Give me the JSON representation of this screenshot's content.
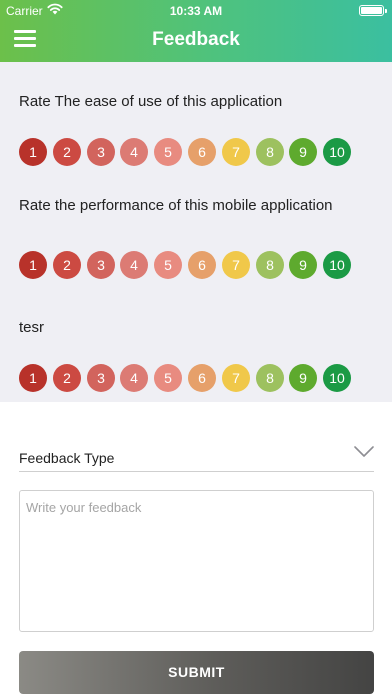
{
  "status_bar": {
    "carrier": "Carrier",
    "time": "10:33 AM"
  },
  "header": {
    "title": "Feedback",
    "menu_icon": "hamburger-menu-icon"
  },
  "scale_colors": [
    "#b8322a",
    "#cc4a42",
    "#d2645d",
    "#dc7b74",
    "#e88b80",
    "#e6a06a",
    "#f0c84a",
    "#9dc15f",
    "#5eaa2e",
    "#1b9a45"
  ],
  "questions": [
    {
      "label": "Rate The ease of use of this application",
      "options": [
        "1",
        "2",
        "3",
        "4",
        "5",
        "6",
        "7",
        "8",
        "9",
        "10"
      ]
    },
    {
      "label": "Rate the performance of this mobile application",
      "options": [
        "1",
        "2",
        "3",
        "4",
        "5",
        "6",
        "7",
        "8",
        "9",
        "10"
      ]
    },
    {
      "label": "tesr",
      "options": [
        "1",
        "2",
        "3",
        "4",
        "5",
        "6",
        "7",
        "8",
        "9",
        "10"
      ]
    }
  ],
  "form": {
    "feedback_type_label": "Feedback Type",
    "feedback_placeholder": "Write your feedback",
    "feedback_value": "",
    "submit_label": "SUBMIT"
  }
}
